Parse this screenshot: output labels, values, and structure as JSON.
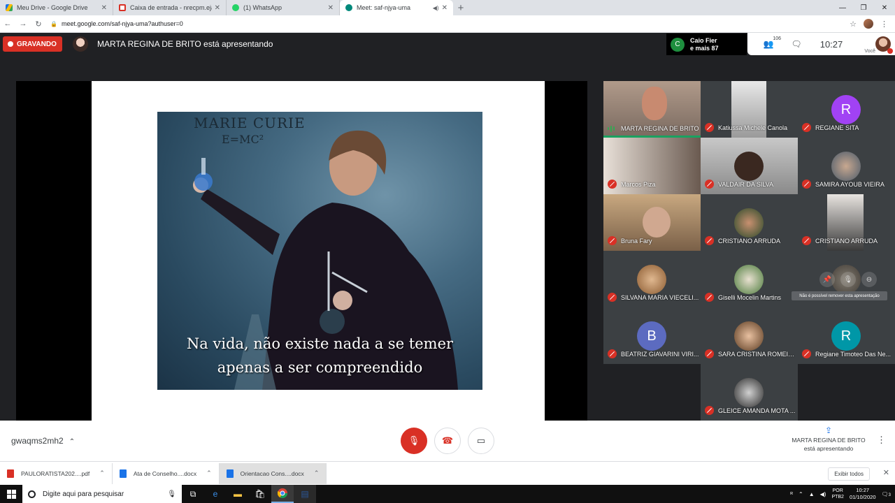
{
  "browser": {
    "tabs": [
      {
        "title": "Meu Drive - Google Drive",
        "color": "#1a73e8"
      },
      {
        "title": "Caixa de entrada - nrecpm.eja@g",
        "color": "#d93025"
      },
      {
        "title": "(1) WhatsApp",
        "color": "#25d366"
      },
      {
        "title": "Meet: saf-njya-uma",
        "color": "#00897b"
      }
    ],
    "url": "meet.google.com/saf-njya-uma?authuser=0"
  },
  "meet": {
    "recording_label": "GRAVANDO",
    "presenting_title": "MARTA REGINA DE BRITO está apresentando",
    "chat_toast": {
      "initial": "C",
      "line1": "Caio Fier",
      "line2": "e mais 87"
    },
    "participant_count": "106",
    "clock": "10:27",
    "you_label": "Você",
    "slide": {
      "title": "MARIE CURIE",
      "formula": "E=MC²",
      "quote_line1": "Na vida, não existe nada a se temer",
      "quote_line2": "apenas a ser compreendido"
    },
    "participants": [
      {
        "name": "MARTA REGINA DE BRITO",
        "speaking": true
      },
      {
        "name": "Katiussa Michele Canola"
      },
      {
        "name": "REGIANE SITA",
        "initial": "R",
        "color": "#a142f4"
      },
      {
        "name": "Marcos Piza"
      },
      {
        "name": "VALDAIR DA SILVA"
      },
      {
        "name": "SAMIRA AYOUB VIEIRA"
      },
      {
        "name": "Bruna Fary"
      },
      {
        "name": "CRISTIANO ARRUDA"
      },
      {
        "name": "CRISTIANO ARRUDA"
      },
      {
        "name": "SILVANA MARIA VIECELI..."
      },
      {
        "name": "Giselli Mocelin Martins"
      },
      {
        "name": ""
      },
      {
        "name": "BEATRIZ GIAVARINI VIRI...",
        "initial": "B",
        "color": "#5c6bc0"
      },
      {
        "name": "SARA CRISTINA ROMEIR..."
      },
      {
        "name": "Regiane Timoteo Das Ne...",
        "initial": "R",
        "color": "#0097a7"
      },
      {
        "name": "GLEICE AMANDA MOTA ..."
      }
    ],
    "tooltip": "Não é possível remover esta apresentação",
    "meeting_code": "gwaqms2mh2",
    "present_line1": "MARTA REGINA DE BRITO",
    "present_line2": "está apresentando"
  },
  "downloads": {
    "items": [
      {
        "name": "PAULORATISTA202....pdf",
        "color": "#d93025"
      },
      {
        "name": "Ata de Conselho....docx",
        "color": "#1a73e8"
      },
      {
        "name": "Orientacao Cons....docx",
        "color": "#1a73e8"
      }
    ],
    "show_all": "Exibir todos"
  },
  "taskbar": {
    "search_placeholder": "Digite aqui para pesquisar",
    "lang_line1": "POR",
    "lang_line2": "PTB2",
    "time": "10:27",
    "date": "01/10/2020",
    "notif_count": "3"
  }
}
